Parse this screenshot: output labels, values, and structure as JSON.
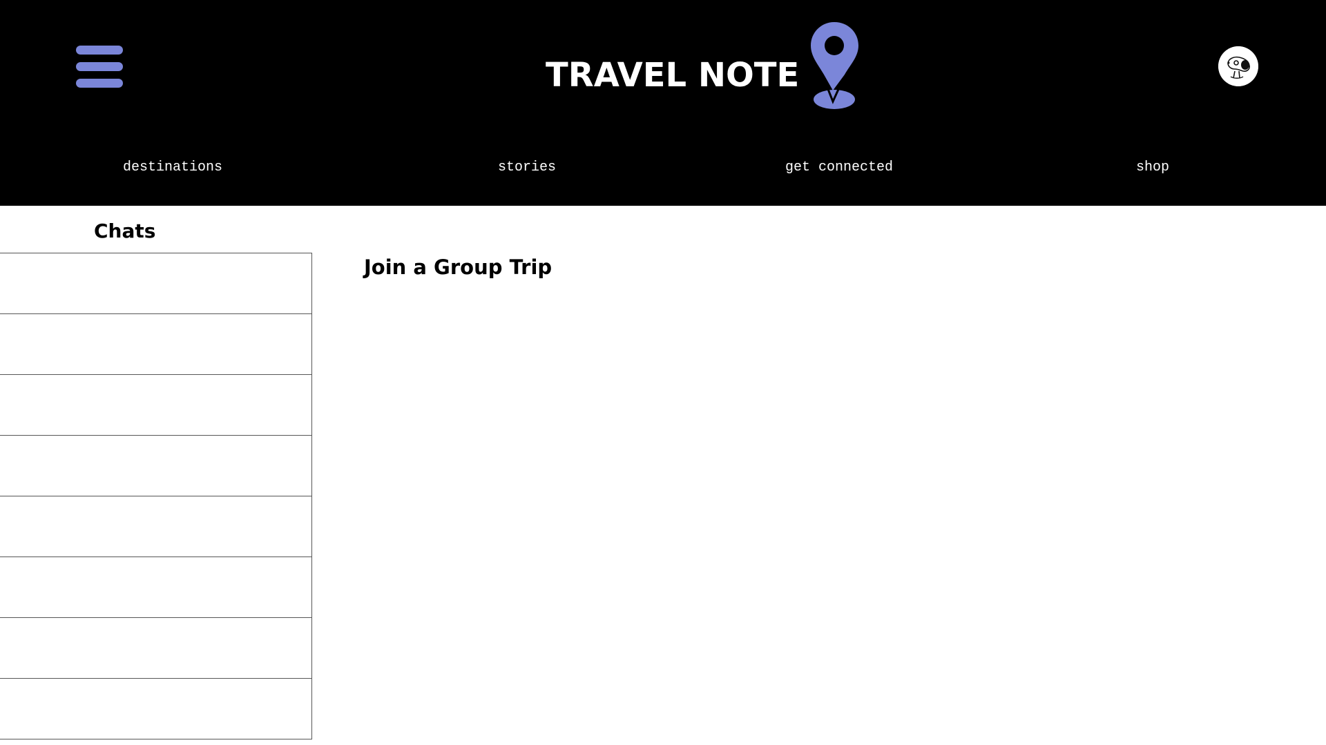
{
  "header": {
    "brand_title": "TRAVEL NOTE",
    "icons": {
      "menu": "hamburger-menu-icon",
      "logo": "map-pin-icon",
      "avatar": "user-avatar"
    },
    "colors": {
      "background": "#000000",
      "accent": "#7b86d9",
      "text": "#ffffff"
    }
  },
  "nav": {
    "items": [
      {
        "label": "destinations"
      },
      {
        "label": "stories"
      },
      {
        "label": "get connected"
      },
      {
        "label": "shop"
      }
    ]
  },
  "sidebar": {
    "title": "Chats",
    "rows": [
      "",
      "",
      "",
      "",
      "",
      "",
      "",
      ""
    ]
  },
  "main": {
    "title": "Join a Group Trip"
  }
}
